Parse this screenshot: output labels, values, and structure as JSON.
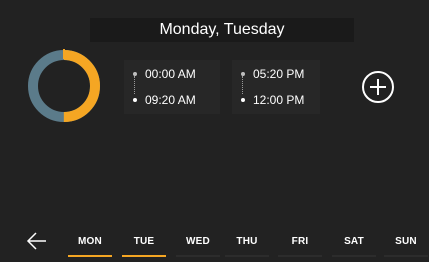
{
  "header": {
    "title": "Monday, Tuesday"
  },
  "colors": {
    "accent": "#f5a623",
    "ring_inactive": "#5b7b8a",
    "background": "#222222"
  },
  "ring": {
    "active_fraction": 0.5
  },
  "slots": [
    {
      "start": "00:00 AM",
      "end": "09:20 AM"
    },
    {
      "start": "05:20 PM",
      "end": "12:00 PM"
    }
  ],
  "add_button": {
    "icon": "plus-circle-icon"
  },
  "back_button": {
    "icon": "arrow-left-icon"
  },
  "days": [
    {
      "label": "MON",
      "selected": true
    },
    {
      "label": "TUE",
      "selected": true
    },
    {
      "label": "WED",
      "selected": false
    },
    {
      "label": "THU",
      "selected": false
    },
    {
      "label": "FRI",
      "selected": false
    },
    {
      "label": "SAT",
      "selected": false
    },
    {
      "label": "SUN",
      "selected": false
    }
  ]
}
